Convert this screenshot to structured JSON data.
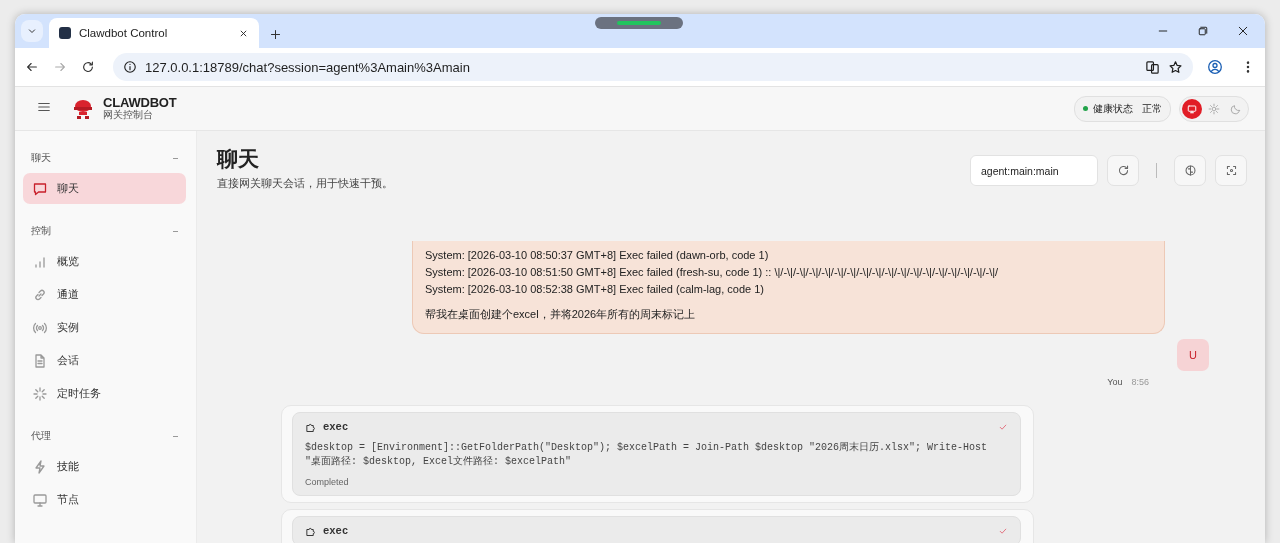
{
  "browser": {
    "tab_title": "Clawdbot Control",
    "url": "127.0.0.1:18789/chat?session=agent%3Amain%3Amain"
  },
  "header": {
    "brand": "CLAWDBOT",
    "subtitle": "网关控制台",
    "health_label": "健康状态",
    "health_value": "正常",
    "theme_options": [
      {
        "kind": "system",
        "selected": true
      },
      {
        "kind": "light",
        "selected": false
      },
      {
        "kind": "dark",
        "selected": false
      }
    ]
  },
  "sidebar": {
    "groups": [
      {
        "title": "聊天",
        "items": [
          {
            "label": "聊天",
            "kind": "chat",
            "selected": true
          }
        ]
      },
      {
        "title": "控制",
        "items": [
          {
            "label": "概览",
            "kind": "chart",
            "selected": false
          },
          {
            "label": "通道",
            "kind": "link",
            "selected": false
          },
          {
            "label": "实例",
            "kind": "radio",
            "selected": false
          },
          {
            "label": "会话",
            "kind": "file",
            "selected": false
          },
          {
            "label": "定时任务",
            "kind": "spark",
            "selected": false
          }
        ]
      },
      {
        "title": "代理",
        "items": [
          {
            "label": "技能",
            "kind": "bolt",
            "selected": false
          },
          {
            "label": "节点",
            "kind": "monitor",
            "selected": false
          }
        ]
      }
    ]
  },
  "page": {
    "title": "聊天",
    "subtitle": "直接网关聊天会话，用于快速干预。",
    "session": "agent:main:main"
  },
  "messages": [
    {
      "lines": [
        "System: [2026-03-10 08:50:37 GMT+8] Exec failed (dawn-orb, code 1)",
        "System: [2026-03-10 08:51:50 GMT+8] Exec failed (fresh-su, code 1) :: \\|/-\\|/-\\|/-\\|/-\\|/-\\|/-\\|/-\\|/-\\|/-\\|/-\\|/-\\|/-\\|/-\\|/-\\|/-\\|/-\\|/-\\|/",
        "System: [2026-03-10 08:52:38 GMT+8] Exec failed (calm-lag, code 1)"
      ],
      "text": "帮我在桌面创建个excel，并将2026年所有的周末标记上",
      "author": "You",
      "time": "8:56",
      "avatar": "U"
    }
  ],
  "tool_calls": [
    {
      "name": "exec",
      "command": "$desktop = [Environment]::GetFolderPath(\"Desktop\"); $excelPath = Join-Path $desktop \"2026周末日历.xlsx\"; Write-Host \"桌面路径: $desktop, Excel文件路径: $excelPath\"",
      "status": "Completed",
      "done": true
    },
    {
      "name": "exec",
      "done": true
    }
  ]
}
